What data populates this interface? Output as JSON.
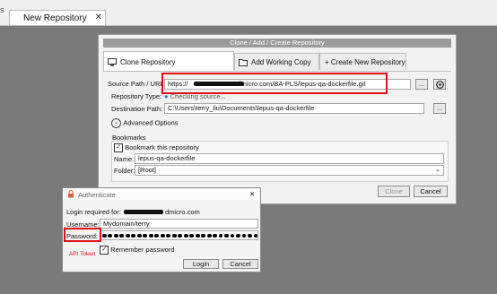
{
  "topbar": {
    "left_stub": "s",
    "tab_label": "New Repository",
    "tab_close": "✕"
  },
  "dialog": {
    "title": "Clone / Add / Create Repository",
    "tabs": [
      {
        "label": "Clone Repository",
        "icon": "computer-icon"
      },
      {
        "label": "Add Working Copy",
        "icon": "folder-icon"
      },
      {
        "label": "+ Create New Repository",
        "icon": "plus-icon"
      }
    ],
    "source_label": "Source Path / URL:",
    "source_prefix": "https://",
    "source_suffix": "dmicro.com/BA-PLS/lepus-qa-dockerfile.git",
    "browse_label": "...",
    "repo_type_label": "Repository Type:",
    "repo_type_value": "Checking source...",
    "dest_label": "Destination Path:",
    "dest_value": "C:\\Users\\terry_liu\\Documents\\lepus-qa-dockerfile",
    "advanced_label": "Advanced Options",
    "bookmarks_label": "Bookmarks",
    "bookmark_checkbox_label": "Bookmark this repository",
    "name_label": "Name:",
    "name_value": "lepus-qa-dockerfile",
    "folder_label": "Folder:",
    "folder_value": "[Root]",
    "clone_btn": "Clone",
    "cancel_btn": "Cancel"
  },
  "auth": {
    "title": "Authenticate",
    "close": "✕",
    "login_required_prefix": "Login required for:",
    "login_required_suffix": "dmicro.com",
    "username_label": "Username:",
    "username_value": "Mydomain/terry",
    "password_label": "Password:",
    "password_dots": 30,
    "annotation": "API Token",
    "remember_label": "Remember password",
    "login_btn": "Login",
    "cancel_btn": "Cancel"
  },
  "colors": {
    "highlight": "#e0101a",
    "background": "#7a7a7a"
  }
}
